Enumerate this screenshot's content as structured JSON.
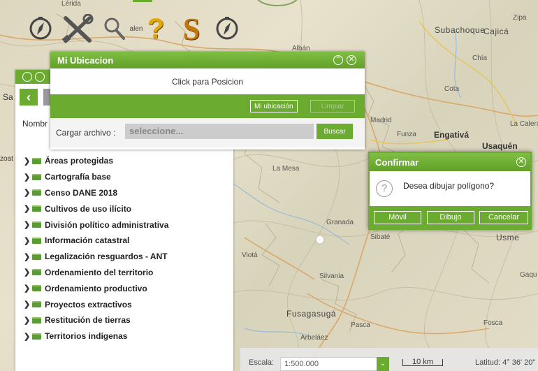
{
  "map": {
    "places": [
      {
        "name": "Lérida"
      },
      {
        "name": "Subachoque"
      },
      {
        "name": "Cajicá"
      },
      {
        "name": "Chía"
      },
      {
        "name": "Cota"
      },
      {
        "name": "Madrid"
      },
      {
        "name": "Funza"
      },
      {
        "name": "Engativá"
      },
      {
        "name": "Usaquén"
      },
      {
        "name": "La Calera"
      },
      {
        "name": "La Mesa"
      },
      {
        "name": "Granada"
      },
      {
        "name": "Sibaté"
      },
      {
        "name": "Usme"
      },
      {
        "name": "Viotá"
      },
      {
        "name": "Silvania"
      },
      {
        "name": "Fusagasugá"
      },
      {
        "name": "Pasca"
      },
      {
        "name": "Arbeláez"
      },
      {
        "name": "Fosca"
      },
      {
        "name": "Gaqu"
      },
      {
        "name": "Albán"
      },
      {
        "name": "Zipa"
      }
    ]
  },
  "toolbar": {
    "help_label": "?",
    "s_label": "S"
  },
  "layer_panel": {
    "left_labels": {
      "sa": "Sa",
      "nombre": "Nombr",
      "zoa": "zoat"
    },
    "layers": [
      "Áreas protegidas",
      "Cartografía base",
      "Censo DANE 2018",
      "Cultivos de uso ilícito",
      "División político administrativa",
      "Información catastral",
      "Legalización resguardos - ANT",
      "Ordenamiento del territorio",
      "Ordenamiento productivo",
      "Proyectos extractivos",
      "Restitución de tierras",
      "Territorios indígenas"
    ]
  },
  "ubicacion": {
    "title": "Mi Ubicacion",
    "click_label": "Click para Posicion",
    "mi_ubicacion_btn": "Mi ubicación",
    "limpiar_btn": "Limpiar",
    "load_label": "Cargar archivo :",
    "file_placeholder": "seleccione...",
    "buscar_btn": "Buscar"
  },
  "confirm": {
    "title": "Confirmar",
    "message": "Desea dibujar polígono?",
    "movil_btn": "Móvil",
    "dibujo_btn": "Dibujo",
    "cancelar_btn": "Cancelar"
  },
  "status": {
    "scale_label": "Escala:",
    "scale_value": "1:500.000",
    "scale_bar_label": "10 km",
    "latitude": "Latitud: 4° 36' 20\" N"
  },
  "colors": {
    "accent_green": "#6bab2f",
    "help_yellow": "#e2a700",
    "s_orange": "#c0760a"
  }
}
